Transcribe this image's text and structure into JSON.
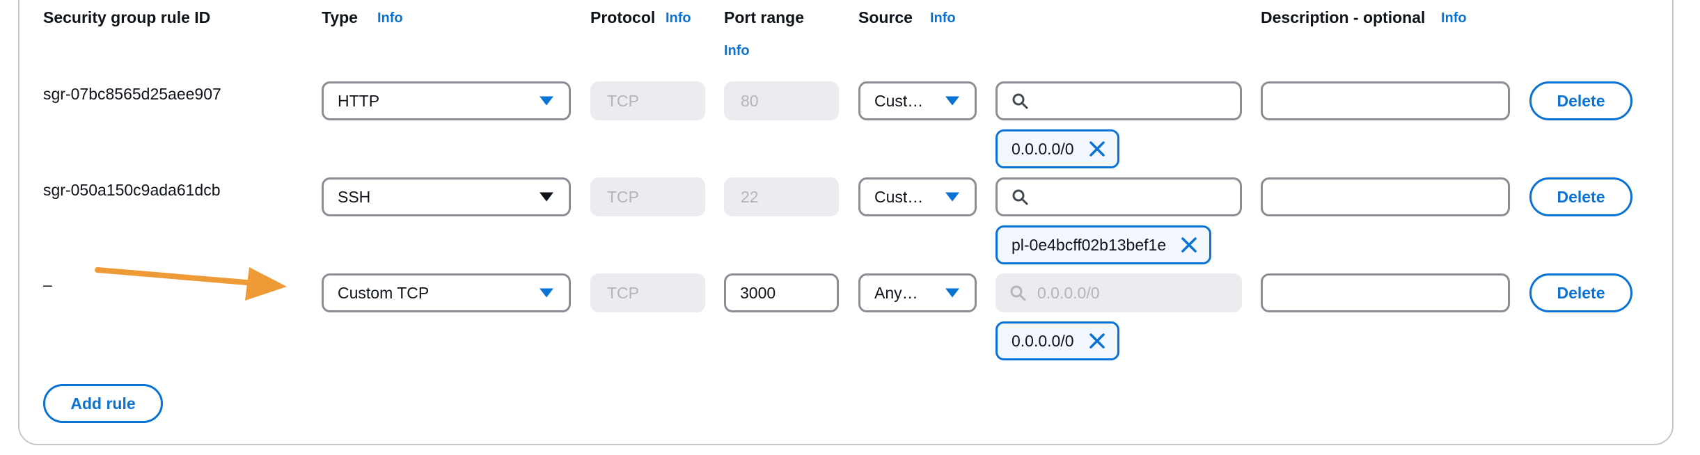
{
  "headers": {
    "rule_id": "Security group rule ID",
    "type": "Type",
    "protocol": "Protocol",
    "port_range": "Port range",
    "source": "Source",
    "description": "Description - optional",
    "info": "Info"
  },
  "rules": [
    {
      "id": "sgr-07bc8565d25aee907",
      "type": "HTTP",
      "protocol": "TCP",
      "port": "80",
      "source_type": "Cust…",
      "search_placeholder": "",
      "token": "0.0.0.0/0",
      "description": "",
      "delete_label": "Delete"
    },
    {
      "id": "sgr-050a150c9ada61dcb",
      "type": "SSH",
      "protocol": "TCP",
      "port": "22",
      "source_type": "Cust…",
      "search_placeholder": "",
      "token": "pl-0e4bcff02b13bef1e",
      "description": "",
      "delete_label": "Delete"
    },
    {
      "id": "–",
      "type": "Custom TCP",
      "protocol": "TCP",
      "port": "3000",
      "source_type": "Any…",
      "search_placeholder": "0.0.0.0/0",
      "token": "0.0.0.0/0",
      "description": "",
      "delete_label": "Delete"
    }
  ],
  "add_rule_label": "Add rule",
  "icons": {
    "dropdown": "chevron-down-icon",
    "search": "search-icon",
    "remove": "close-icon",
    "annotation": "arrow-icon"
  },
  "colors": {
    "link_blue": "#0972d3",
    "annotation_arrow": "#ee9a36",
    "border_gray": "#8c8c94",
    "disabled_bg": "#ebebf0"
  }
}
